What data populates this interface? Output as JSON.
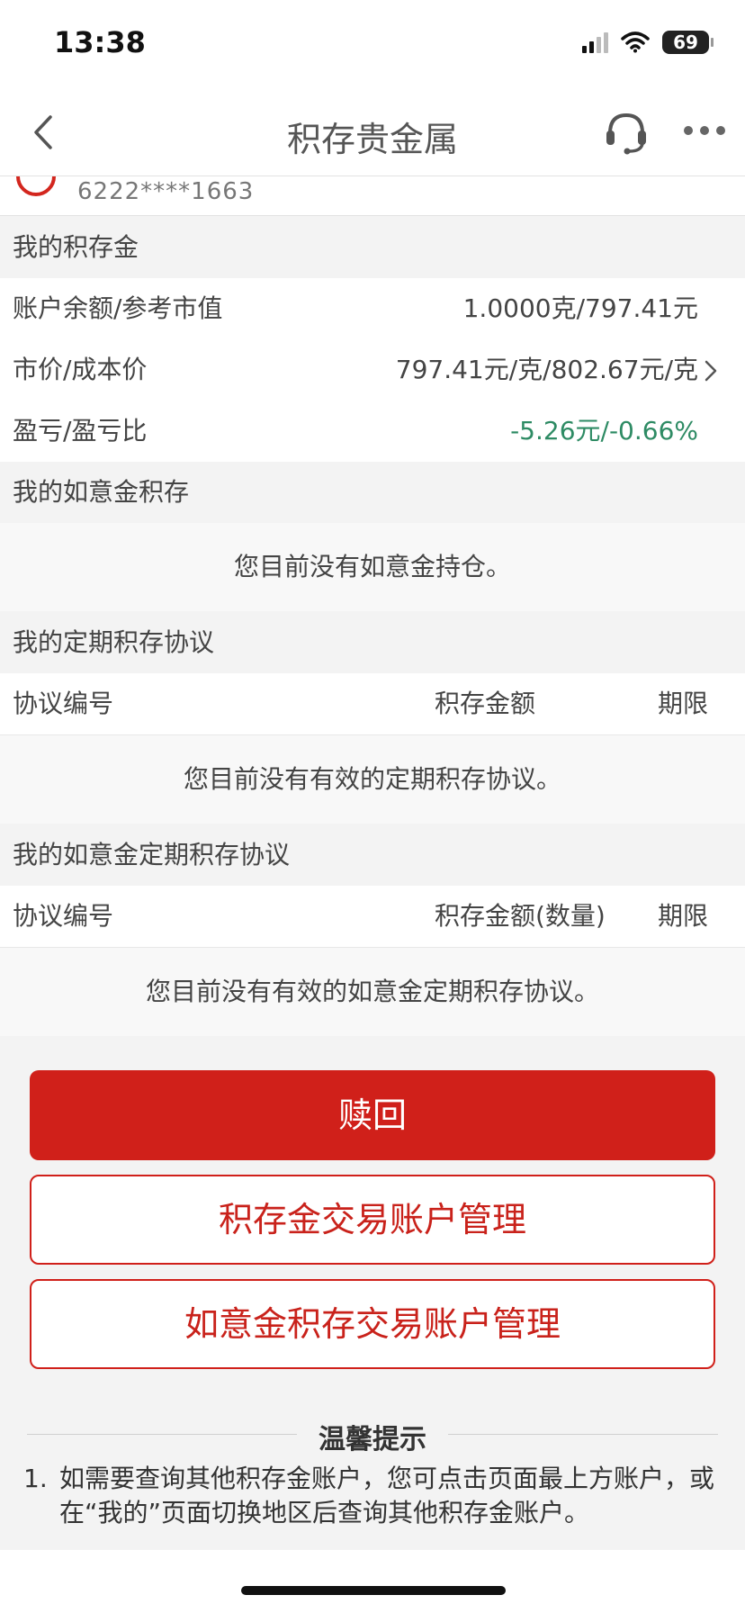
{
  "status": {
    "time": "13:38",
    "battery": "69"
  },
  "nav": {
    "title": "积存贵金属"
  },
  "account": {
    "number": "6222****1663"
  },
  "my_gold": {
    "header": "我的积存金",
    "rows": [
      {
        "label": "账户余额/参考市值",
        "value": "1.0000克/797.41元"
      },
      {
        "label": "市价/成本价",
        "value": "797.41元/克/802.67元/克"
      },
      {
        "label": "盈亏/盈亏比",
        "value": "-5.26元/-0.66%"
      }
    ]
  },
  "ruyi": {
    "header": "我的如意金积存",
    "empty": "您目前没有如意金持仓。"
  },
  "regular": {
    "header": "我的定期积存协议",
    "columns": {
      "no": "协议编号",
      "amount": "积存金额",
      "term": "期限"
    },
    "empty": "您目前没有有效的定期积存协议。"
  },
  "ruyi_regular": {
    "header": "我的如意金定期积存协议",
    "columns": {
      "no": "协议编号",
      "amount": "积存金额(数量)",
      "term": "期限"
    },
    "empty": "您目前没有有效的如意金定期积存协议。"
  },
  "buttons": {
    "redeem": "赎回",
    "gold_account": "积存金交易账户管理",
    "ruyi_account": "如意金积存交易账户管理"
  },
  "tips": {
    "title": "温馨提示",
    "items": [
      {
        "num": "1.",
        "text": "如需要查询其他积存金账户，您可点击页面最上方账户，或在“我的”页面切换地区后查询其他积存金账户。"
      }
    ]
  },
  "colors": {
    "accent": "#d0201a",
    "gain_loss": "#2e8b64"
  }
}
